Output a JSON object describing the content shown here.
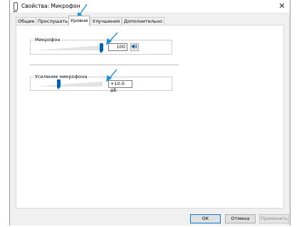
{
  "window": {
    "title": "Свойства: Микрофон",
    "close_label": "✕"
  },
  "tabs": [
    {
      "label": "Общие",
      "active": false
    },
    {
      "label": "Прослушать",
      "active": false
    },
    {
      "label": "Уровни",
      "active": true
    },
    {
      "label": "Улучшения",
      "active": false
    },
    {
      "label": "Дополнительно",
      "active": false
    }
  ],
  "microphone": {
    "label": "Микрофон",
    "value": "100",
    "level": 1.0,
    "speaker_icon": "speaker-icon"
  },
  "boost": {
    "label": "Усиление микрофона",
    "value": "+10.0 дБ",
    "level": 0.33
  },
  "buttons": {
    "ok": "OK",
    "cancel": "Отмена",
    "apply": "Применить"
  },
  "colors": {
    "accent": "#0063b1",
    "annotation_arrow": "#1e90d6"
  }
}
